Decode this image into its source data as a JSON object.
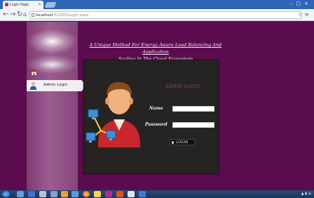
{
  "browser": {
    "tab_title": "Login Page",
    "url_host": "localhost",
    "url_path": ":51350/Login.aspx"
  },
  "page": {
    "title_line1": "A Unique Method For Energy Aware Load Balancing And Application",
    "title_line2": "Scaling In The Cloud Ecosystem",
    "nav": {
      "admin_login": "Admin Login"
    },
    "login": {
      "heading": "ADMIN LOGIN",
      "name_label": "Name",
      "password_label": "Password",
      "name_value": "",
      "password_value": "",
      "button_label": "LOGIN"
    }
  },
  "colors": {
    "page_background": "#5b0c4f",
    "side_panel": "#8e4f83",
    "login_panel": "#262323",
    "login_heading": "#a23a86"
  },
  "icons": {
    "home": "home-icon",
    "user": "user-icon",
    "lock": "lock-icon"
  }
}
